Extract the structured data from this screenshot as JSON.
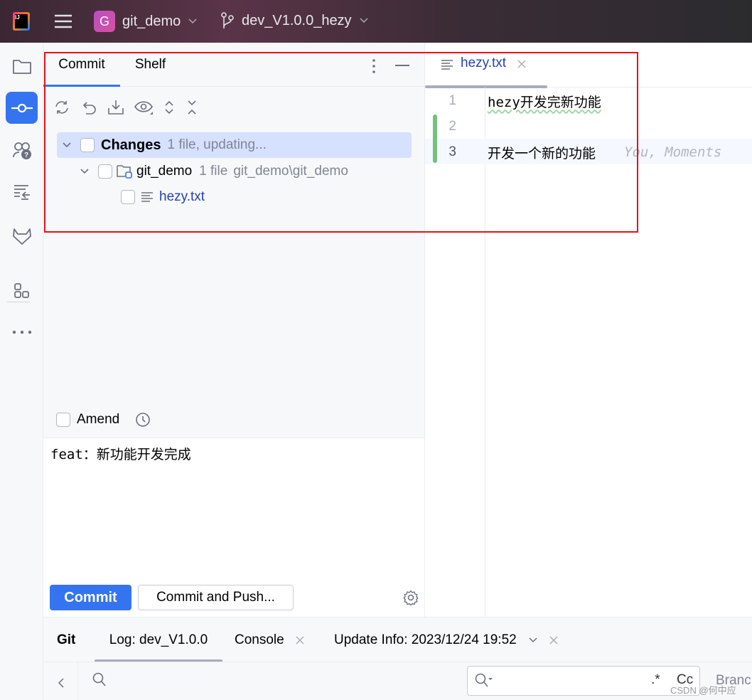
{
  "titlebar": {
    "project_initial": "G",
    "project": "git_demo",
    "branch": "dev_V1.0.0_hezy",
    "project_color": "#c64aa8"
  },
  "commit_panel": {
    "tabs": [
      {
        "label": "Commit",
        "active": true
      },
      {
        "label": "Shelf",
        "active": false
      }
    ],
    "tree": {
      "root": {
        "label": "Changes",
        "meta": "1 file, updating..."
      },
      "module": {
        "label": "git_demo",
        "count": "1 file",
        "path": "git_demo\\git_demo"
      },
      "file": {
        "label": "hezy.txt"
      }
    },
    "amend_label": "Amend",
    "message": "feat：新功能开发完成",
    "commit_button": "Commit",
    "commit_push_button": "Commit and Push..."
  },
  "editor": {
    "tab": "hezy.txt",
    "lines": [
      {
        "num": "1",
        "text": "hezy开发完新功能"
      },
      {
        "num": "2",
        "text": ""
      },
      {
        "num": "3",
        "text": "开发一个新的功能",
        "annotation": "You, Moments"
      }
    ]
  },
  "bottom": {
    "title": "Git",
    "tabs": [
      {
        "label": "Log: dev_V1.0.0",
        "active": true
      },
      {
        "label": "Console"
      },
      {
        "label": "Update Info: 2023/12/24 19:52"
      }
    ],
    "search_right": {
      "regex": ".*",
      "case": "Cc"
    },
    "branch_label": "Branc"
  },
  "watermark": "CSDN @何中应",
  "colors": {
    "accent": "#3574f0",
    "highlight_box": "#e8101a",
    "selection": "#d5e1ff",
    "added_line": "#73c17b"
  }
}
